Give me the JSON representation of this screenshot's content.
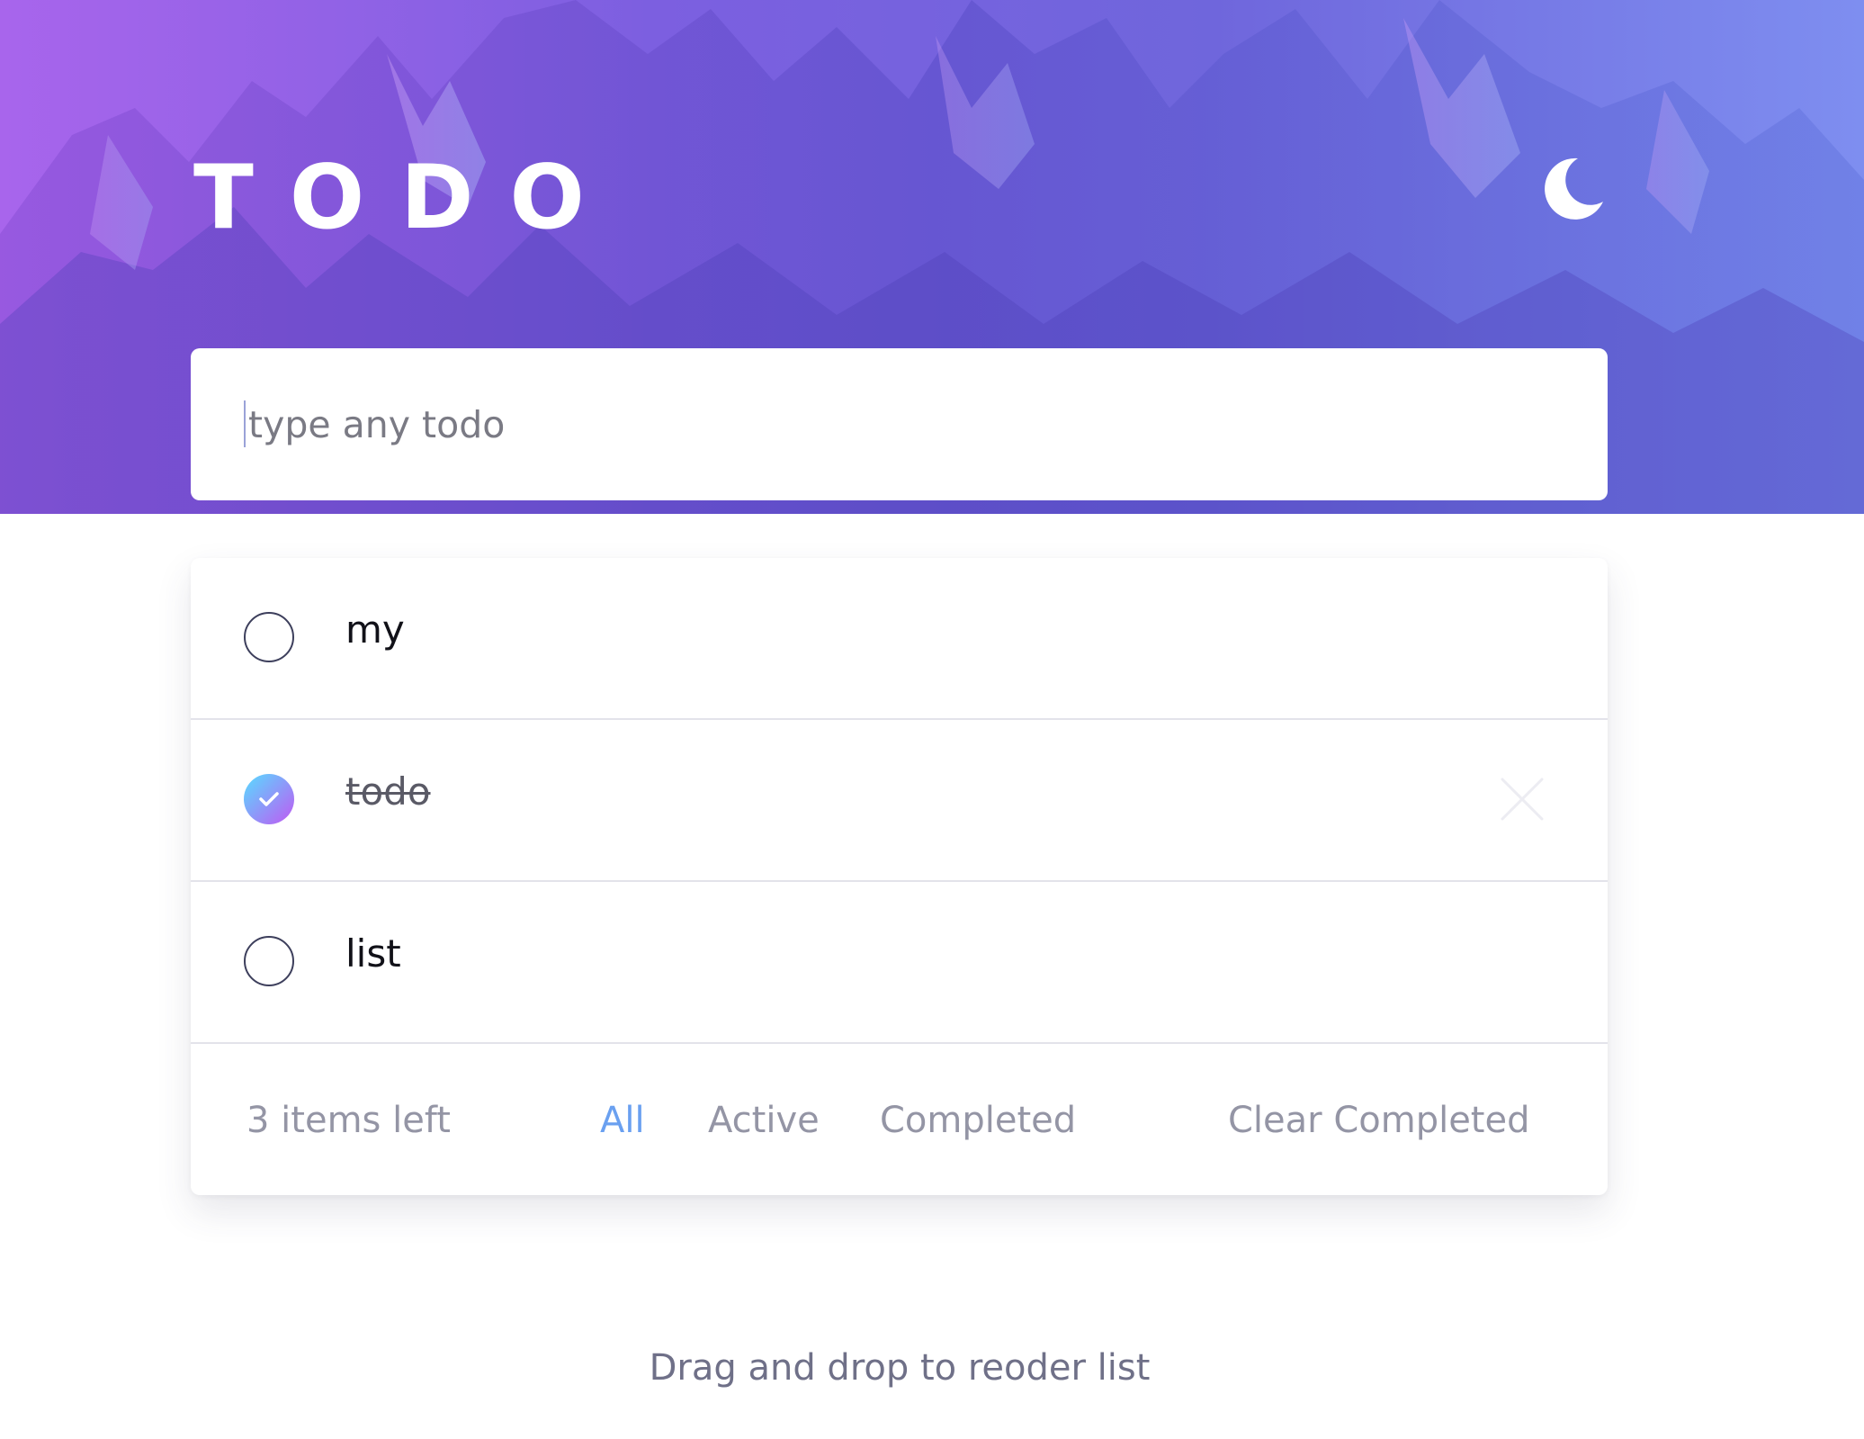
{
  "header": {
    "title": "TODO",
    "theme_toggle_icon": "moon-icon"
  },
  "new_todo": {
    "placeholder": "type any todo",
    "value": ""
  },
  "todos": [
    {
      "text": "my",
      "completed": false
    },
    {
      "text": "todo",
      "completed": true
    },
    {
      "text": "list",
      "completed": false
    }
  ],
  "footer": {
    "items_left": "3 items left",
    "filters": {
      "all": "All",
      "active": "Active",
      "completed": "Completed"
    },
    "selected_filter": "All",
    "clear_completed": "Clear Completed"
  },
  "hint": "Drag and drop to reoder list",
  "colors": {
    "accent": "#6aa0f0",
    "check_gradient_start": "#57ddff",
    "check_gradient_end": "#c058f3",
    "muted_text": "#9495a5"
  }
}
